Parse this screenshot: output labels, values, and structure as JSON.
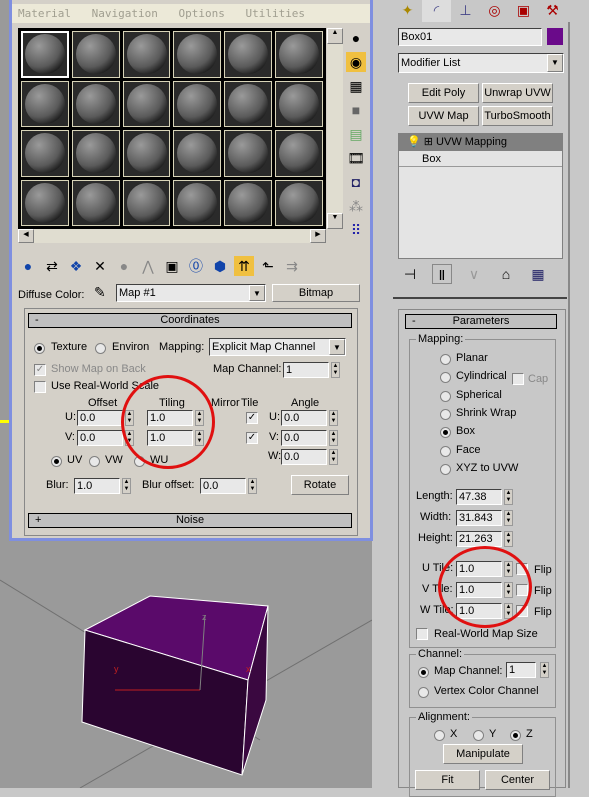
{
  "menu": [
    "Material",
    "Navigation",
    "Options",
    "Utilities"
  ],
  "sample_slots": 24,
  "diffuse": {
    "label": "Diffuse Color:",
    "map": "Map #1",
    "type_button": "Bitmap"
  },
  "coordinates": {
    "title": "Coordinates",
    "collapse": "-",
    "texture": "Texture",
    "environ": "Environ",
    "mapping_label": "Mapping:",
    "mapping_value": "Explicit Map Channel",
    "show_map_on_back": "Show Map on Back",
    "real_world": "Use Real-World Scale",
    "map_channel_label": "Map Channel:",
    "map_channel": "1",
    "offset": "Offset",
    "tiling": "Tiling",
    "mirror": "Mirror",
    "tile": "Tile",
    "angle": "Angle",
    "u": "U:",
    "v": "V:",
    "w": "W:",
    "offset_u": "0.0",
    "offset_v": "0.0",
    "tiling_u": "1.0",
    "tiling_v": "1.0",
    "angle_u": "0.0",
    "angle_v": "0.0",
    "angle_w": "0.0",
    "uv": "UV",
    "vw": "VW",
    "wu": "WU",
    "blur_label": "Blur:",
    "blur": "1.0",
    "blur_offset_label": "Blur offset:",
    "blur_offset": "0.0",
    "rotate": "Rotate"
  },
  "noise": {
    "title": "Noise",
    "expand": "+"
  },
  "command_panel": {
    "object_name": "Box01",
    "object_color": "#6a0a8a",
    "modifier_list": "Modifier List",
    "buttons": [
      "Edit Poly",
      "Unwrap UVW",
      "UVW Map",
      "TurboSmooth"
    ],
    "stack": [
      "UVW Mapping",
      "Box"
    ]
  },
  "parameters": {
    "title": "Parameters",
    "collapse": "-",
    "mapping_label": "Mapping:",
    "types": [
      "Planar",
      "Cylindrical",
      "Spherical",
      "Shrink Wrap",
      "Box",
      "Face",
      "XYZ to UVW"
    ],
    "selected": "Box",
    "cap": "Cap",
    "length_label": "Length:",
    "length": "47.38",
    "width_label": "Width:",
    "width": "31.843",
    "height_label": "Height:",
    "height": "21.263",
    "u_tile_label": "U Tile:",
    "u_tile": "1.0",
    "v_tile_label": "V Tile:",
    "v_tile": "1.0",
    "w_tile_label": "W Tile:",
    "w_tile": "1.0",
    "flip": "Flip",
    "real_world": "Real-World Map Size",
    "channel_label": "Channel:",
    "map_channel_label": "Map Channel:",
    "map_channel": "1",
    "vertex_color": "Vertex Color Channel",
    "alignment_label": "Alignment:",
    "x": "X",
    "y": "Y",
    "z": "Z",
    "manipulate": "Manipulate",
    "fit": "Fit",
    "center": "Center"
  },
  "highlight_color": "#e01010"
}
